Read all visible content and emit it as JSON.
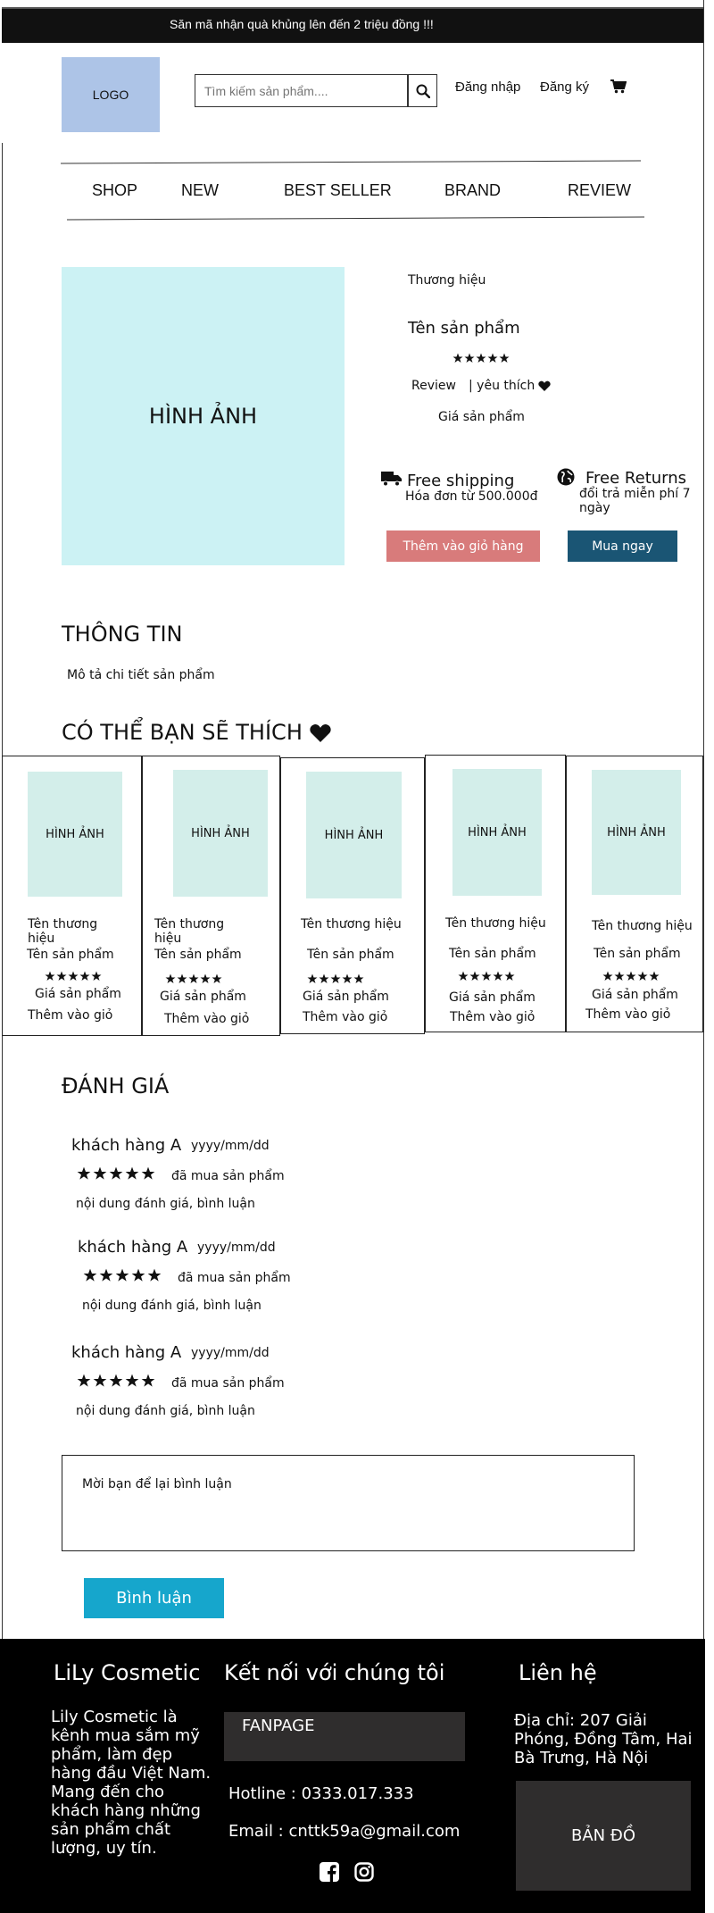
{
  "announcement": "Săn mã nhận quà khủng lên đến 2 triệu đồng !!!",
  "header": {
    "logo": "LOGO",
    "search_placeholder": "Tìm kiếm sản phẩm....",
    "login": "Đăng nhập",
    "register": "Đăng ký",
    "icons": {
      "search": "search-icon",
      "cart": "cart-icon"
    }
  },
  "nav": [
    "SHOP",
    "NEW",
    "BEST SELLER",
    "BRAND",
    "REVIEW"
  ],
  "product": {
    "image_label": "HÌNH ẢNH",
    "brand": "Thương hiệu",
    "name": "Tên sản phẩm",
    "rating": 5,
    "review": "Review",
    "like": "| yêu thích",
    "price": "Giá sản phẩm",
    "shipping_title": "Free shipping",
    "shipping_sub": "Hóa đơn từ 500.000đ",
    "returns_title": "Free Returns",
    "returns_sub": "đổi trả miễn phí 7 ngày",
    "add_to_cart": "Thêm vào giỏ hàng",
    "buy_now": "Mua ngay"
  },
  "info": {
    "title": "THÔNG TIN",
    "description": "Mô tả chi tiết sản phẩm"
  },
  "recommend": {
    "title": "CÓ THỂ BẠN SẼ THÍCH",
    "cards": [
      {
        "image": "HÌNH ẢNH",
        "brand": "Tên thương hiệu",
        "name": "Tên sản phẩm",
        "rating": 5,
        "price": "Giá sản phẩm",
        "add": "Thêm vào giỏ"
      },
      {
        "image": "HÌNH ẢNH",
        "brand": "Tên thương hiệu",
        "name": "Tên sản phẩm",
        "rating": 5,
        "price": "Giá sản phẩm",
        "add": "Thêm vào giỏ"
      },
      {
        "image": "HÌNH ẢNH",
        "brand": "Tên thương hiệu",
        "name": "Tên sản phẩm",
        "rating": 5,
        "price": "Giá sản phẩm",
        "add": "Thêm vào giỏ"
      },
      {
        "image": "HÌNH ẢNH",
        "brand": "Tên thương hiệu",
        "name": "Tên sản phẩm",
        "rating": 5,
        "price": "Giá sản phẩm",
        "add": "Thêm vào giỏ"
      },
      {
        "image": "HÌNH ẢNH",
        "brand": "Tên thương hiệu",
        "name": "Tên sản phẩm",
        "rating": 5,
        "price": "Giá sản phẩm",
        "add": "Thêm vào giỏ"
      }
    ]
  },
  "reviews": {
    "title": "ĐÁNH GIÁ",
    "items": [
      {
        "customer": "khách hàng A",
        "date": "yyyy/mm/dd",
        "rating": 5,
        "bought": "đã mua sản phẩm",
        "content": "nội dung đánh giá, bình luận"
      },
      {
        "customer": "khách hàng A",
        "date": "yyyy/mm/dd",
        "rating": 5,
        "bought": "đã mua sản phẩm",
        "content": "nội dung đánh giá, bình luận"
      },
      {
        "customer": "khách hàng A",
        "date": "yyyy/mm/dd",
        "rating": 5,
        "bought": "đã mua sản phẩm",
        "content": "nội dung đánh giá, bình luận"
      }
    ],
    "comment_placeholder": "Mời bạn để lại bình luận",
    "comment_button": "Bình luận"
  },
  "footer": {
    "brand_title": "LiLy Cosmetic",
    "brand_desc": "Lily Cosmetic là kênh mua sắm mỹ phẩm, làm đẹp hàng đầu Việt Nam. Mang đến cho khách hàng những sản phẩm chất lượng, uy tín.",
    "connect_title": "Kết nối với chúng tôi",
    "fanpage": "FANPAGE",
    "hotline": "Hotline : 0333.017.333",
    "email": "Email : cnttk59a@gmail.com",
    "contact_title": "Liên hệ",
    "address": "Địa chỉ: 207 Giải Phóng, Đồng Tâm, Hai Bà Trưng, Hà Nội",
    "map": "BẢN ĐỒ",
    "social_icons": [
      "facebook-icon",
      "instagram-icon"
    ]
  },
  "colors": {
    "accent_blue": "#16a6cc",
    "add_to_cart": "#d87b7b",
    "buy_now": "#1a5574",
    "hero_image": "#ccf2f4",
    "card_image": "#d3eeea",
    "logo_bg": "#adc4e7"
  }
}
